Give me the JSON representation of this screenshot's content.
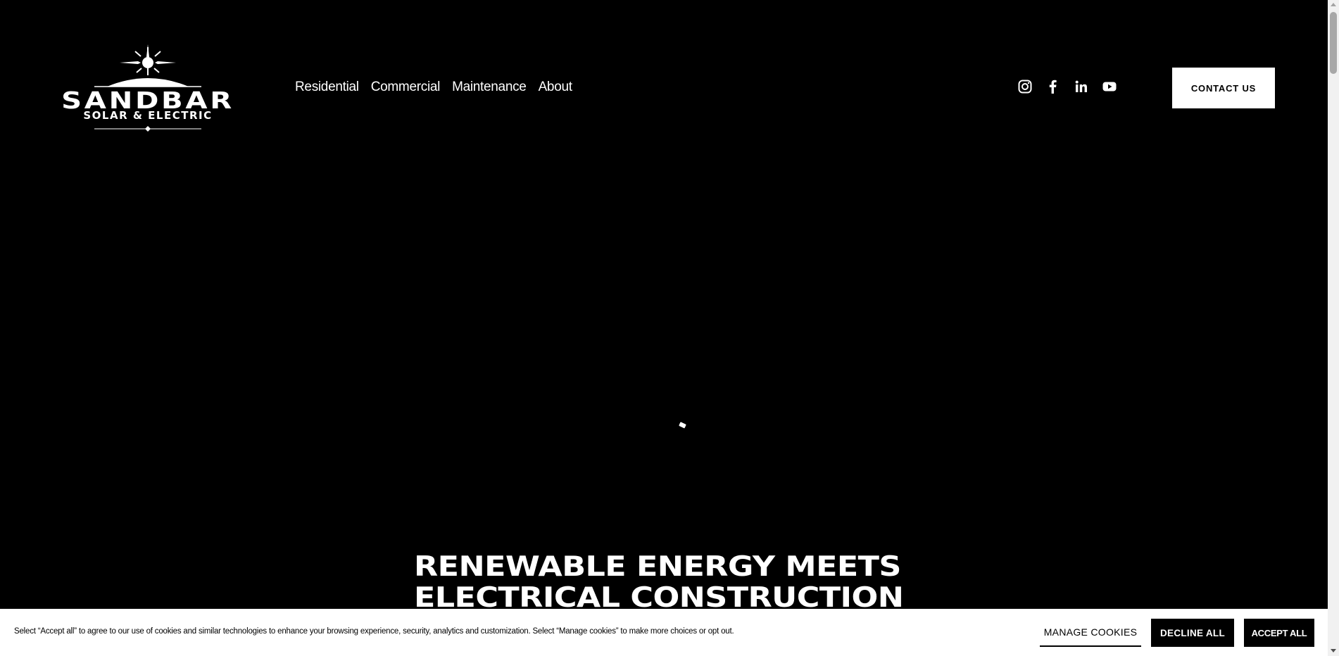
{
  "header": {
    "logo": {
      "main": "SANDBAR",
      "sub": "SOLAR & ELECTRIC",
      "icon": "sun-logo-icon"
    },
    "nav": [
      {
        "label": "Residential"
      },
      {
        "label": "Commercial"
      },
      {
        "label": "Maintenance"
      },
      {
        "label": "About"
      }
    ],
    "social": [
      "instagram-icon",
      "facebook-icon",
      "linkedin-icon",
      "youtube-icon"
    ],
    "contact_label": "CONTACT US"
  },
  "hero": {
    "title_line1": "RENEWABLE ENERGY MEETS",
    "title_line2": "ELECTRICAL CONSTRUCTION",
    "background": "#000000"
  },
  "cookie": {
    "text": "Select “Accept all” to agree to our use of cookies and similar technologies to enhance your browsing experience, security, analytics and customization. Select “Manage cookies” to make more choices or opt out.",
    "manage_label": "MANAGE COOKIES",
    "decline_label": "DECLINE ALL",
    "accept_label": "ACCEPT ALL"
  },
  "colors": {
    "background": "#000000",
    "foreground": "#ffffff",
    "banner": "#ffffff"
  }
}
